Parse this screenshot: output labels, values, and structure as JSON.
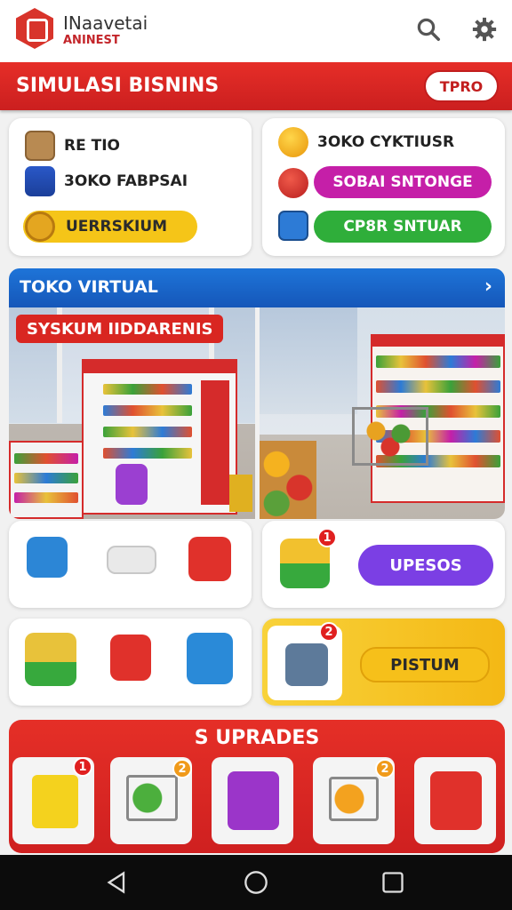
{
  "app": {
    "brand_line1": "INaavetai",
    "brand_line2": "ANINEST",
    "logo_icon": "store-logo"
  },
  "toolbar": {
    "search_icon": "search-icon",
    "settings_icon": "gear-icon"
  },
  "header": {
    "title": "SIMULASI BISNINS",
    "button_label": "TPRO"
  },
  "stats_left": {
    "row1": "RE TIO",
    "row2": "3OKO FABPSAI",
    "pill": "UERRSKIUM",
    "pill_color": "#f5c518"
  },
  "stats_right": {
    "row1": "3OKO CYKTIUSR",
    "pill1": "SOBAI SNTONGE",
    "pill1_color": "#c51fa8",
    "pill2": "CP8R SNTUAR",
    "pill2_color": "#2fae3a"
  },
  "toko": {
    "title": "TOKO VIRTUAL",
    "photo_label": "SYSKUM IIDDARENIS"
  },
  "cards": {
    "card_a_icons": [
      "shopping-bag-icon",
      "delivery-truck-icon",
      "gift-box-icon"
    ],
    "card_b": {
      "badge": "1",
      "button": "UPESOS",
      "button_color": "#7b3fe4"
    },
    "card_c_icons": [
      "product-box-icon",
      "first-aid-bag-icon",
      "shopping-cart-icon"
    ],
    "card_d": {
      "badge": "2",
      "button": "PISTUM",
      "bg_color": "#f6c721"
    }
  },
  "upgrades": {
    "title": "S UPRADES",
    "items": [
      {
        "icon": "yellow-box-icon",
        "badge": "1"
      },
      {
        "icon": "vegetable-cart-icon",
        "badge": "2"
      },
      {
        "icon": "purple-box-icon",
        "badge": ""
      },
      {
        "icon": "fruit-cart-icon",
        "badge": "2"
      },
      {
        "icon": "red-bag-icon",
        "badge": ""
      }
    ]
  },
  "nav": {
    "back": "back-icon",
    "home": "home-icon",
    "recent": "recent-apps-icon"
  }
}
